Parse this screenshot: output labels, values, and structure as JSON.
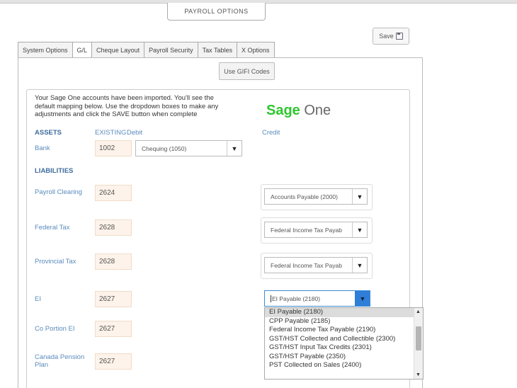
{
  "header": {
    "title": "PAYROLL OPTIONS",
    "save_label": "Save"
  },
  "tabs": [
    {
      "label": "System Options"
    },
    {
      "label": "G/L"
    },
    {
      "label": "Cheque Layout"
    },
    {
      "label": "Payroll Security"
    },
    {
      "label": "Tax Tables"
    },
    {
      "label": "X Options"
    }
  ],
  "gifi_button": "Use GIFI Codes",
  "intro": {
    "line1": "Your Sage One accounts have been imported. You'll see the",
    "line2": "default mapping below. Use the dropdown boxes to make any",
    "line3": "adjustments and click the SAVE button when complete"
  },
  "logo": {
    "bold": "Sage",
    "light": "One",
    "color": "#2ec62e"
  },
  "columns": {
    "assets": "ASSETS",
    "existing": "EXISTING",
    "debit": "Debit",
    "credit": "Credit"
  },
  "bank": {
    "label": "Bank",
    "account": "1002",
    "debit": "Chequing (1050)"
  },
  "liabilities_title": "LIABILITIES",
  "rows": {
    "payroll_clearing": {
      "label": "Payroll Clearing",
      "account": "2624",
      "credit": "Accounts Payable (2000)"
    },
    "federal_tax": {
      "label": "Federal Tax",
      "account": "2628",
      "credit": "Federal Income Tax Payab"
    },
    "provincial_tax": {
      "label": "Provincial Tax",
      "account": "2628",
      "credit": "Federal Income Tax Payab"
    },
    "ei": {
      "label": "EI",
      "account": "2627",
      "credit": "EI Payable (2180)"
    },
    "co_portion_ei": {
      "label": "Co Portion EI",
      "account": "2627"
    },
    "canada_pension": {
      "label_line1": "Canada Pension",
      "label_line2": "Plan",
      "account": "2627"
    }
  },
  "dropdown_options": [
    "EI Payable (2180)",
    "CPP Payable (2185)",
    "Federal Income Tax Payable (2190)",
    "GST/HST Collected and Collectible (2300)",
    "GST/HST Input Tax Credits (2301)",
    "GST/HST Payable (2350)",
    "PST Collected on Sales (2400)"
  ],
  "icons": {
    "save": "floppy-disk-icon",
    "dropdown": "triangle-down-icon"
  }
}
